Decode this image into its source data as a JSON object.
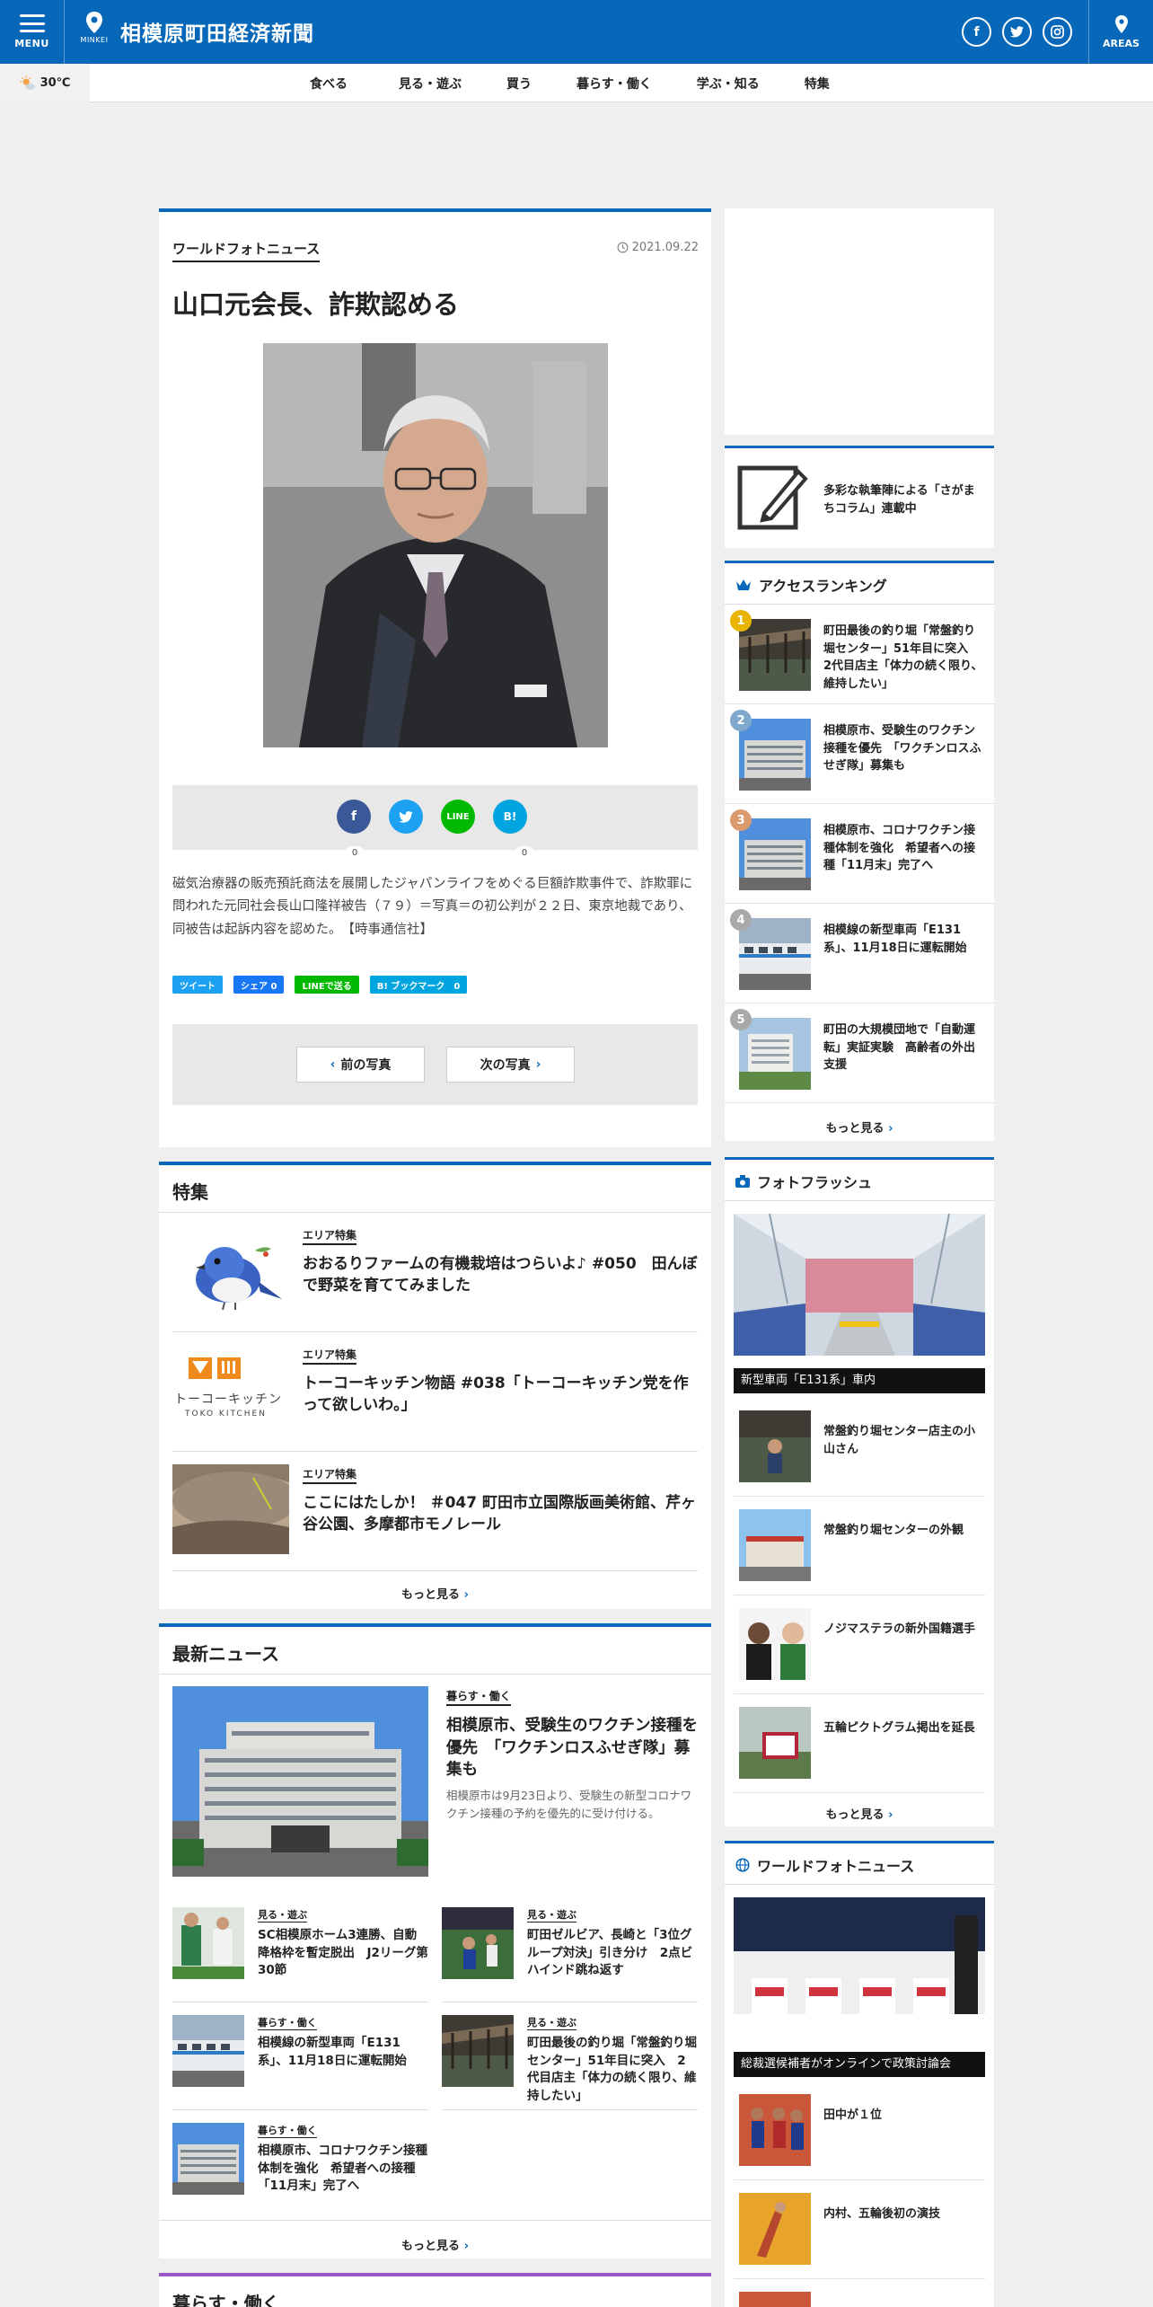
{
  "header": {
    "menu_label": "MENU",
    "site_title": "相模原町田経済新聞",
    "logo_sub": "MINKEI",
    "areas_label": "AREAS",
    "social": [
      "f",
      "t",
      "ig"
    ]
  },
  "weather": {
    "temp": "30℃"
  },
  "nav": [
    "食べる",
    "見る・遊ぶ",
    "買う",
    "暮らす・働く",
    "学ぶ・知る",
    "特集"
  ],
  "article": {
    "category": "ワールドフォトニュース",
    "date": "2021.09.22",
    "title": "山口元会長、詐欺認める",
    "share": {
      "fb": "f",
      "tw": "t",
      "line": "LINE",
      "hb": "B!",
      "fb_count": "0",
      "hb_count": "0"
    },
    "body": "磁気治療器の販売預託商法を展開したジャパンライフをめぐる巨額詐欺事件で、詐欺罪に問われた元同社会長山口隆祥被告（７９）＝写真＝の初公判が２２日、東京地裁であり、同被告は起訴内容を認めた。　【時事通信社】",
    "mini_share": [
      "ツイート",
      "シェア 0",
      "LINEで送る",
      "B! ブックマーク　0"
    ],
    "prev_label": "前の写真",
    "next_label": "次の写真"
  },
  "feature": {
    "title": "特集",
    "items": [
      {
        "category": "エリア特集",
        "title": "おおるりファームの有機栽培はつらいよ♪ #050　田んぼで野菜を育ててみました"
      },
      {
        "category": "エリア特集",
        "title": "トーコーキッチン物語 #038「トーコーキッチン党を作って欲しいわ。」"
      },
      {
        "category": "エリア特集",
        "title": "ここにはたしか！ ＃047 町田市立国際版画美術館、芹ヶ谷公園、多摩都市モノレール"
      }
    ],
    "toko_logo_text": "トーコーキッチン",
    "toko_logo_sub": "TOKO KITCHEN",
    "more": "もっと見る"
  },
  "latest": {
    "title": "最新ニュース",
    "lead": {
      "category": "暮らす・働く",
      "title": "相模原市、受験生のワクチン接種を優先　「ワクチンロスふせぎ隊」募集も",
      "desc": "相模原市は9月23日より、受験生の新型コロナワクチン接種の予約を優先的に受け付ける。"
    },
    "items": [
      {
        "category": "見る・遊ぶ",
        "title": "SC相模原ホーム3連勝、自動降格枠を暫定脱出　J2リーグ第30節"
      },
      {
        "category": "見る・遊ぶ",
        "title": "町田ゼルビア、長崎と「3位グループ対決」引き分け　2点ビハインド跳ね返す"
      },
      {
        "category": "暮らす・働く",
        "title": "相模線の新型車両「E131系」、11月18日に運転開始"
      },
      {
        "category": "見る・遊ぶ",
        "title": "町田最後の釣り堀「常盤釣り堀センター」51年目に突入　2代目店主「体力の続く限り、維持したい」"
      },
      {
        "category": "暮らす・働く",
        "title": "相模原市、コロナワクチン接種体制を強化　希望者への接種「11月末」完了へ"
      }
    ],
    "more": "もっと見る"
  },
  "kurasu": {
    "title": "暮らす・働く"
  },
  "sidebar": {
    "column_text": "多彩な執筆陣による「さがまちコラム」連載中",
    "ranking": {
      "title": "アクセスランキング",
      "items": [
        {
          "rank": "1",
          "title": "町田最後の釣り堀「常盤釣り堀センター」51年目に突入　2代目店主「体力の続く限り、維持したい」"
        },
        {
          "rank": "2",
          "title": "相模原市、受験生のワクチン接種を優先　「ワクチンロスふせぎ隊」募集も"
        },
        {
          "rank": "3",
          "title": "相模原市、コロナワクチン接種体制を強化　希望者への接種「11月末」完了へ"
        },
        {
          "rank": "4",
          "title": "相模線の新型車両「E131系」、11月18日に運転開始"
        },
        {
          "rank": "5",
          "title": "町田の大規模団地で「自動運転」実証実験　高齢者の外出支援"
        }
      ],
      "badge_colors": [
        "#e8b400",
        "#7fa8cc",
        "#d99a6c",
        "#a9a9a9",
        "#a9a9a9"
      ],
      "more": "もっと見る"
    },
    "photo_flash": {
      "title": "フォトフラッシュ",
      "main_caption": "新型車両「E131系」車内",
      "items": [
        "常盤釣り堀センター店主の小山さん",
        "常盤釣り堀センターの外観",
        "ノジマステラの新外国籍選手",
        "五輪ピクトグラム掲出を延長"
      ],
      "more": "もっと見る"
    },
    "world": {
      "title": "ワールドフォトニュース",
      "main_caption": "総裁選候補者がオンラインで政策討論会",
      "items": [
        "田中が１位",
        "内村、五輪後初の演技"
      ]
    }
  },
  "colors": {
    "brand": "#0767b9",
    "accent_purple": "#9b57c9"
  }
}
